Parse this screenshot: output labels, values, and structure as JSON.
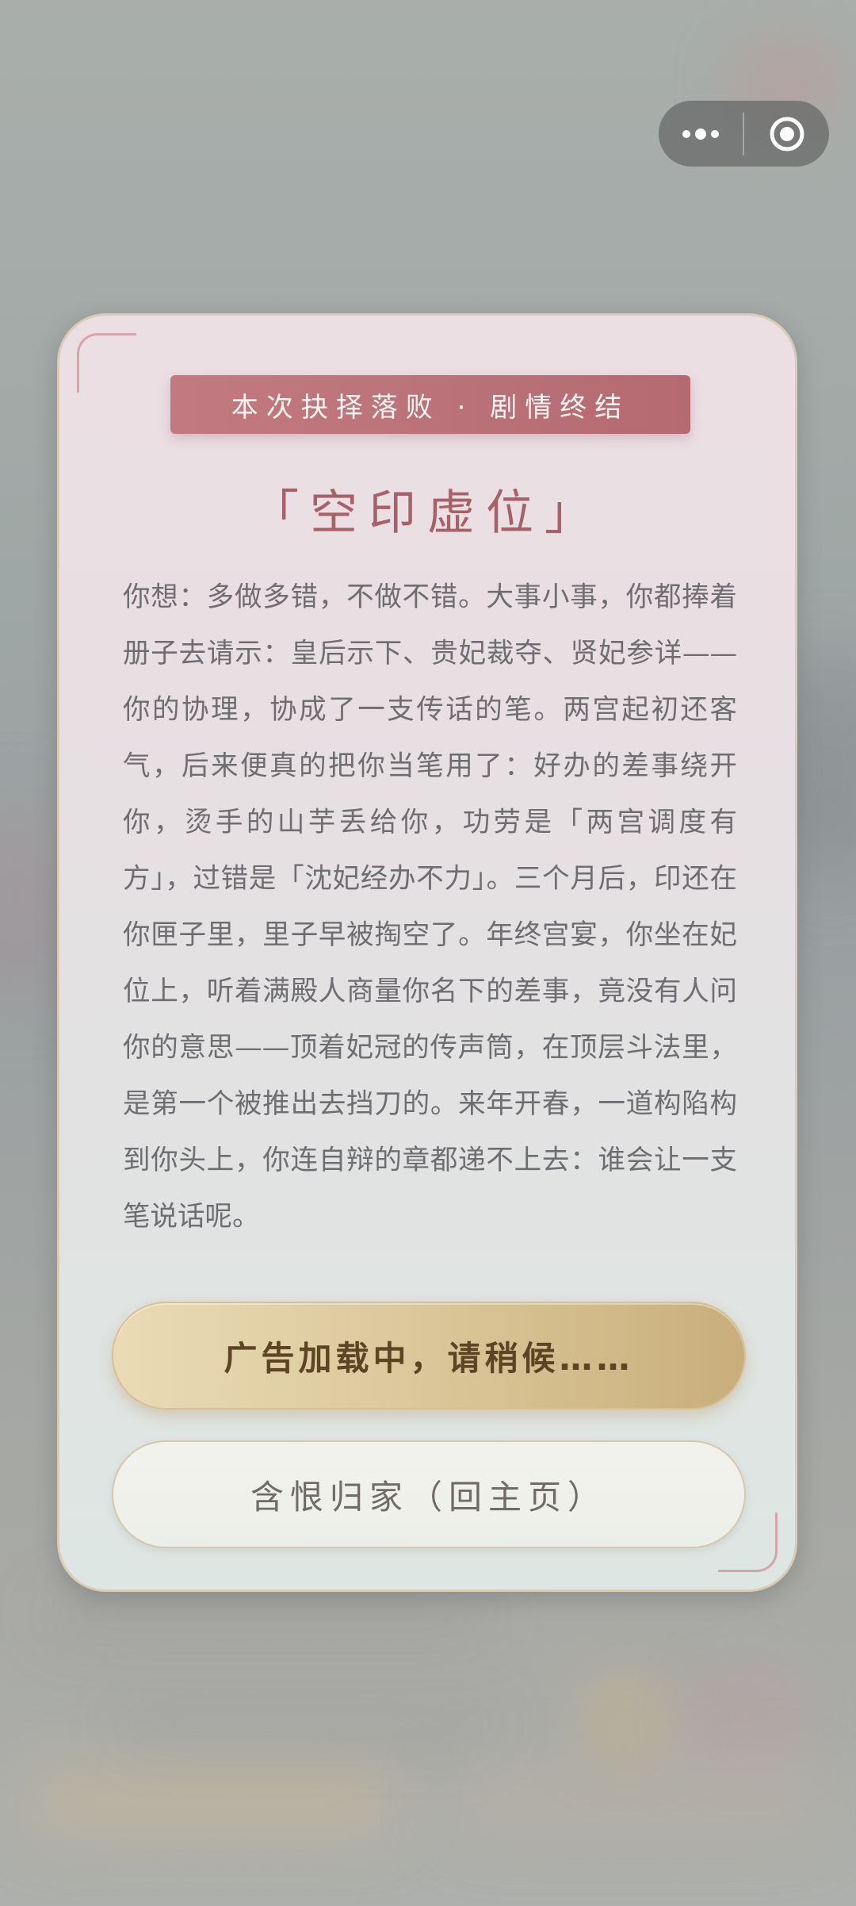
{
  "capsule": {
    "more_icon": "more-dots-icon",
    "close_icon": "target-circle-icon"
  },
  "result": {
    "banner": "本次抉择落败 · 剧情终结",
    "title": "「空印虚位」",
    "story": "你想：多做多错，不做不错。大事小事，你都捧着册子去请示：皇后示下、贵妃裁夺、贤妃参详——你的协理，协成了一支传话的笔。两宫起初还客气，后来便真的把你当笔用了：好办的差事绕开你，烫手的山芋丢给你，功劳是「两宫调度有方」，过错是「沈妃经办不力」。三个月后，印还在你匣子里，里子早被掏空了。年终宫宴，你坐在妃位上，听着满殿人商量你名下的差事，竟没有人问你的意思——顶着妃冠的传声筒，在顶层斗法里，是第一个被推出去挡刀的。来年开春，一道构陷构到你头上，你连自辩的章都递不上去：谁会让一支笔说话呢。",
    "ad_button": "广告加载中，请稍候……",
    "home_button": "含恨归家（回主页）"
  },
  "colors": {
    "banner": "#b56a72",
    "title": "#a86267",
    "ad_button": "#d9c495",
    "story_text": "#6e6d72"
  }
}
